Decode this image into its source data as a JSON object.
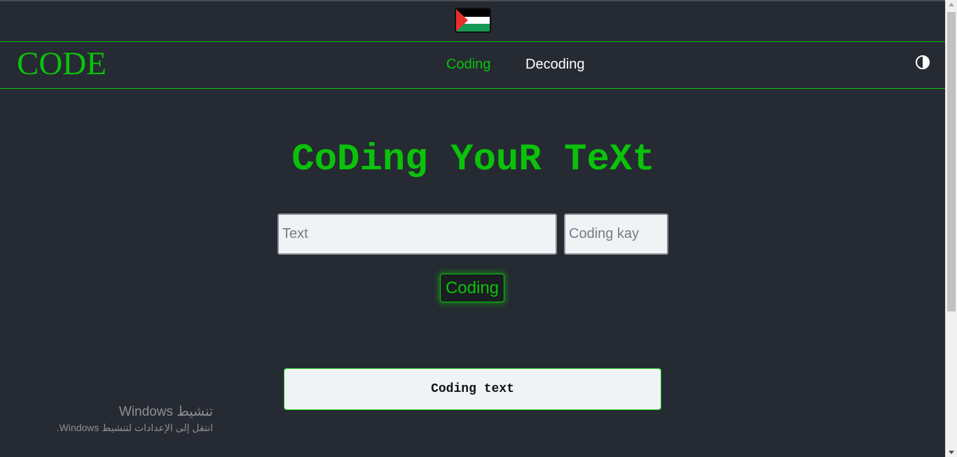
{
  "colors": {
    "accent": "#0ac20a",
    "background": "#262a33",
    "input_bg": "#eff3f6",
    "nav_inactive": "#ffffff"
  },
  "flag": {
    "icon": "palestine-flag-icon",
    "colors": [
      "#000000",
      "#ffffff",
      "#149954",
      "#e4312b"
    ]
  },
  "navbar": {
    "brand": "CODE",
    "links": [
      {
        "label": "Coding",
        "active": true
      },
      {
        "label": "Decoding",
        "active": false
      }
    ],
    "theme_toggle_icon": "contrast-icon"
  },
  "main": {
    "title": "CoDing YouR TeXt",
    "text_input": {
      "placeholder": "Text",
      "value": ""
    },
    "key_input": {
      "placeholder": "Coding kay",
      "value": ""
    },
    "submit_label": "Coding",
    "output_text": "Coding text"
  },
  "watermark": {
    "title": "تنشيط Windows",
    "subtitle": "انتقل إلى الإعدادات لتنشيط Windows."
  }
}
